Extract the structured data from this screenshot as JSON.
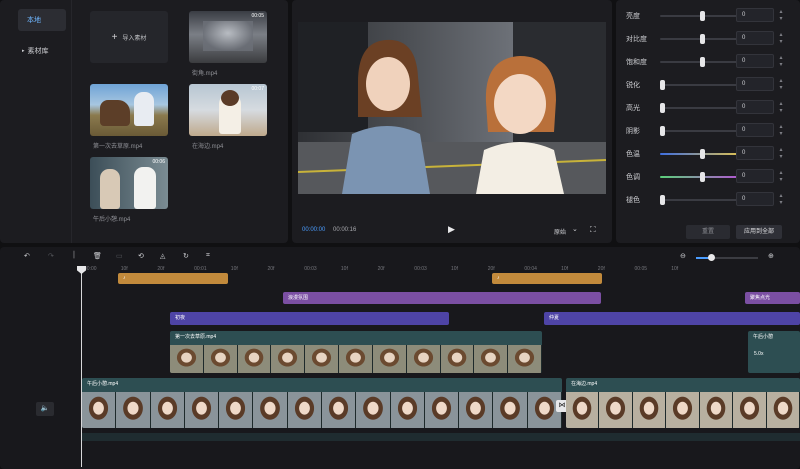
{
  "nav": {
    "local": "本地",
    "library": "素材库"
  },
  "media": {
    "import_label": "导入素材",
    "items": [
      {
        "caption": "街角.mp4",
        "duration": "00:05"
      },
      {
        "caption": "第一次去草原.mp4",
        "duration": "00:06"
      },
      {
        "caption": "在海边.mp4",
        "duration": "00:07"
      },
      {
        "caption": "午后小憩.mp4",
        "duration": "00:06"
      }
    ]
  },
  "player": {
    "current_time": "00:00:00",
    "total_time": "00:00:16",
    "ratio_label": "原始"
  },
  "adjust": {
    "rows": [
      {
        "label": "亮度",
        "value": "0",
        "level": 0.5
      },
      {
        "label": "对比度",
        "value": "0",
        "level": 0.5
      },
      {
        "label": "饱和度",
        "value": "0",
        "level": 0.5
      },
      {
        "label": "锐化",
        "value": "0",
        "level": 0.0
      },
      {
        "label": "高光",
        "value": "0",
        "level": 0.0
      },
      {
        "label": "阴影",
        "value": "0",
        "level": 0.0
      },
      {
        "label": "色温",
        "value": "0",
        "level": 0.5
      },
      {
        "label": "色调",
        "value": "0",
        "level": 0.5
      },
      {
        "label": "褪色",
        "value": "0",
        "level": 0.0
      }
    ],
    "reset_label": "重置",
    "apply_all_label": "应用到全部"
  },
  "timeline": {
    "ruler": [
      "00:00",
      "10f",
      "20f",
      "00:01",
      "10f",
      "20f",
      "00:03",
      "10f",
      "20f",
      "00:03",
      "10f",
      "20f",
      "00:04",
      "10f",
      "20f",
      "00:05",
      "10f"
    ],
    "effect1": "浪漫氛围",
    "effect2": "聚焦点光",
    "filter1": "初夜",
    "filter2": "仲夏",
    "clip_upper": "第一次去草原.mp4",
    "clip_main1": "午后小憩.mp4",
    "clip_main2": "在海边.mp4",
    "mini_speed": "5.0x",
    "mini_label": "午后小憩"
  },
  "colors": {
    "accent": "#4b9dff",
    "effect": "#7b4fa3",
    "filter": "#4e44a6",
    "audio": "#c28a3c",
    "video": "#2d4e52"
  }
}
